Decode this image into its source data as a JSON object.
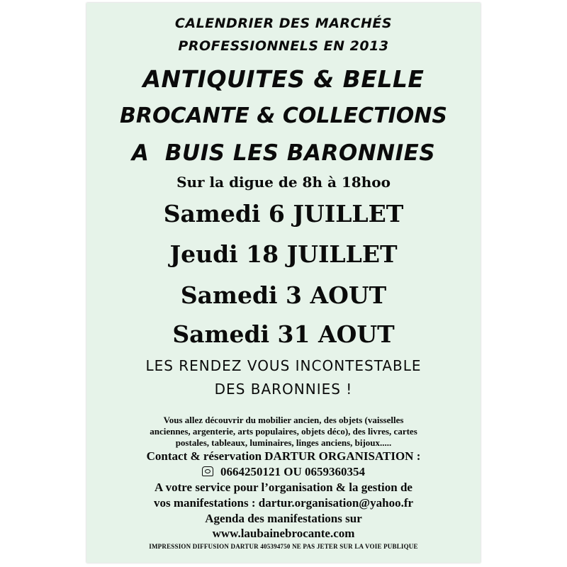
{
  "header": {
    "line1": "CALENDRIER DES MARCHÉS",
    "line2": "PROFESSIONNELS EN 2013"
  },
  "title": {
    "line1": "ANTIQUITES & BELLE",
    "line2": "BROCANTE & COLLECTIONS",
    "line3": "A  BUIS LES BARONNIES"
  },
  "location": "Sur la digue de 8h à 18hoo",
  "dates": [
    "Samedi 6 JUILLET",
    "Jeudi 18 JUILLET",
    "Samedi 3 AOUT",
    "Samedi 31 AOUT"
  ],
  "slogan": {
    "line1": "LES RENDEZ VOUS INCONTESTABLE",
    "line2": "DES BARONNIES !"
  },
  "description": {
    "line1": "Vous allez découvrir du mobilier ancien, des objets (vaisselles",
    "line2": "anciennes, argenterie, arts populaires, objets déco), des livres, cartes",
    "line3": "postales, tableaux, luminaires, linges anciens, bijoux....."
  },
  "contact": {
    "label": "Contact & réservation DARTUR ORGANISATION :",
    "phones": "0664250121 OU 0659360354",
    "phone_icon": "telephone-icon",
    "service_line1": "A votre service pour l’organisation & la gestion de",
    "service_line2": "vos manifestations : dartur.organisation@yahoo.fr",
    "agenda": "Agenda des manifestations sur",
    "website": "www.laubainebrocante.com"
  },
  "footer": "IMPRESSION DIFFUSION DARTUR 405394750 NE PAS JETER SUR LA VOIE PUBLIQUE",
  "colors": {
    "paper": "#e6f3e9",
    "ink": "#0b0b0b"
  }
}
